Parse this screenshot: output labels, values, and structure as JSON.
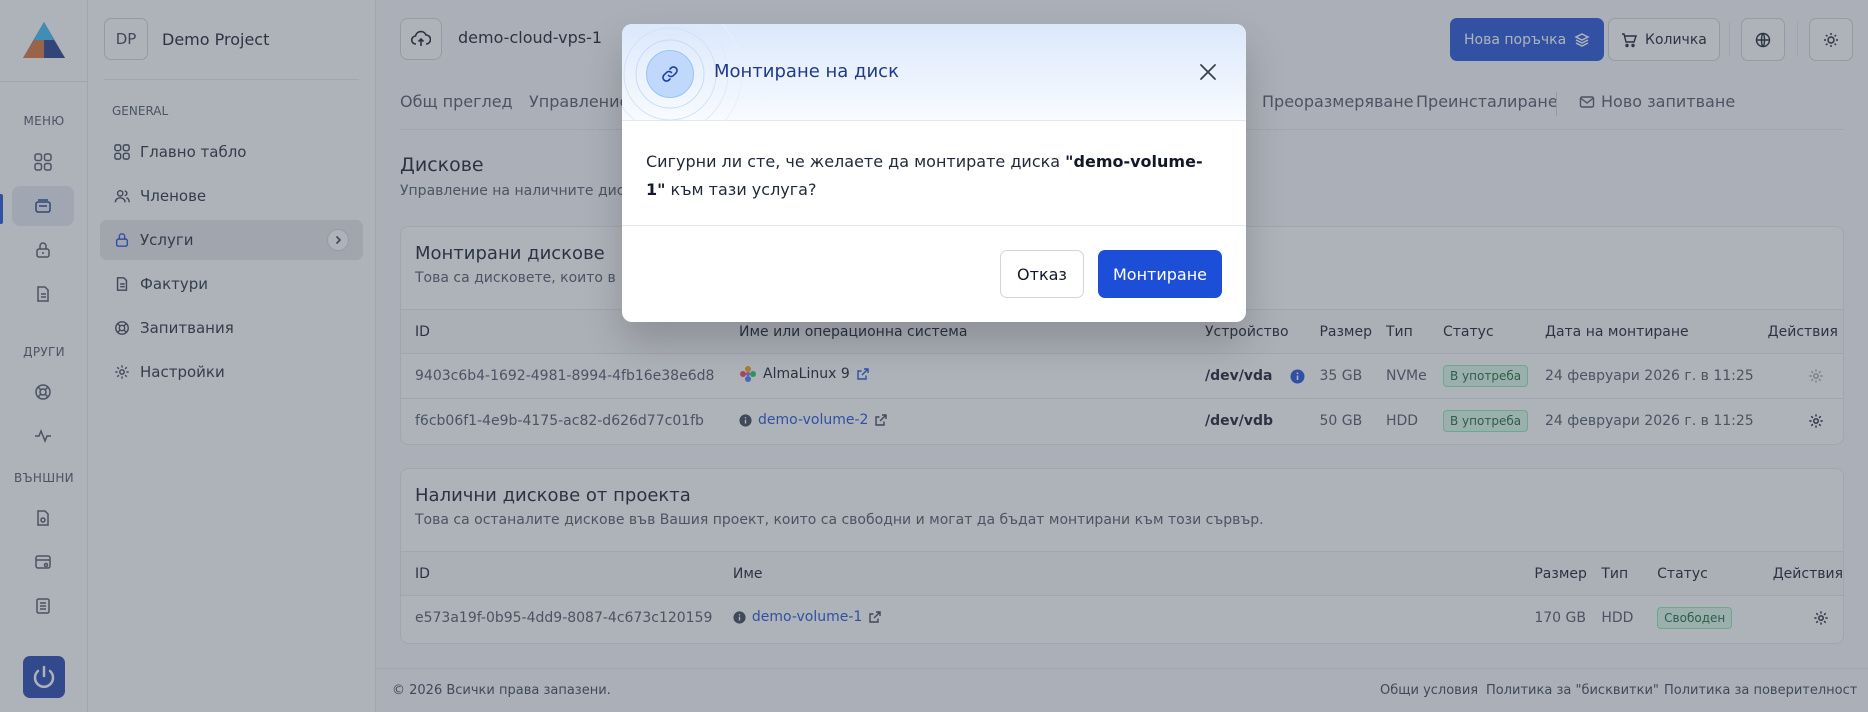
{
  "rail": {
    "label_menu": "МЕНЮ",
    "label_others": "ДРУГИ",
    "label_external": "ВЪНШНИ",
    "accent": "#1e40af"
  },
  "project": {
    "avatar": "DP",
    "name": "Demo Project"
  },
  "sidebar": {
    "group": "GENERAL",
    "items": [
      {
        "label": "Главно табло",
        "icon": "dashboard-icon"
      },
      {
        "label": "Членове",
        "icon": "users-icon"
      },
      {
        "label": "Услуги",
        "icon": "services-icon",
        "active": true
      },
      {
        "label": "Фактури",
        "icon": "invoice-icon"
      },
      {
        "label": "Запитвания",
        "icon": "support-icon"
      },
      {
        "label": "Настройки",
        "icon": "gear-icon"
      }
    ]
  },
  "topbar": {
    "server_name": "demo-cloud-vps-1",
    "new_order": "Нова поръчка",
    "cart": "Количка"
  },
  "tabs": {
    "overview": "Общ преглед",
    "manage": "Управление",
    "resize": "Преоразмеряване",
    "reinstall": "Преинсталиране",
    "new_ticket": "Ново запитване"
  },
  "disks": {
    "title": "Дискове",
    "subtitle": "Управление на наличните диск"
  },
  "mounted": {
    "title": "Монтирани дискове",
    "desc": "Това са дисковете, които в",
    "headers": [
      "ID",
      "Име или операционна система",
      "Устройство",
      "Размер",
      "Тип",
      "Статус",
      "Дата на монтиране",
      "Действия"
    ],
    "rows": [
      {
        "id": "9403c6b4-1692-4981-8994-4fb16e38e6d8",
        "name": "AlmaLinux 9",
        "device": "/dev/vda",
        "size": "35 GB",
        "type": "NVMe",
        "status": "В употреба",
        "date": "24 февруари 2026 г. в 11:25"
      },
      {
        "id": "f6cb06f1-4e9b-4175-ac82-d626d77c01fb",
        "name": "demo-volume-2",
        "device": "/dev/vdb",
        "size": "50 GB",
        "type": "HDD",
        "status": "В употреба",
        "date": "24 февруари 2026 г. в 11:25"
      }
    ]
  },
  "available": {
    "title": "Налични дискове от проекта",
    "desc": "Това са останалите дискове във Вашия проект, които са свободни и могат да бъдат монтирани към този сървър.",
    "headers": [
      "ID",
      "Име",
      "Размер",
      "Тип",
      "Статус",
      "Действия"
    ],
    "rows": [
      {
        "id": "e573a19f-0b95-4dd9-8087-4c673c120159",
        "name": "demo-volume-1",
        "size": "170 GB",
        "type": "HDD",
        "status": "Свободен"
      }
    ]
  },
  "footer": {
    "copyright": "© 2026 Всички права запазени.",
    "terms": "Общи условия",
    "cookies": "Политика за \"бисквитки\"",
    "privacy": "Политика за поверителност"
  },
  "modal": {
    "title": "Монтиране на диск",
    "body_before": "Сигурни ли сте, че желаете да монтирате диска ",
    "body_volume": "\"demo-volume-1\"",
    "body_after": " към тази услуга?",
    "cancel": "Отказ",
    "confirm": "Монтиране"
  }
}
